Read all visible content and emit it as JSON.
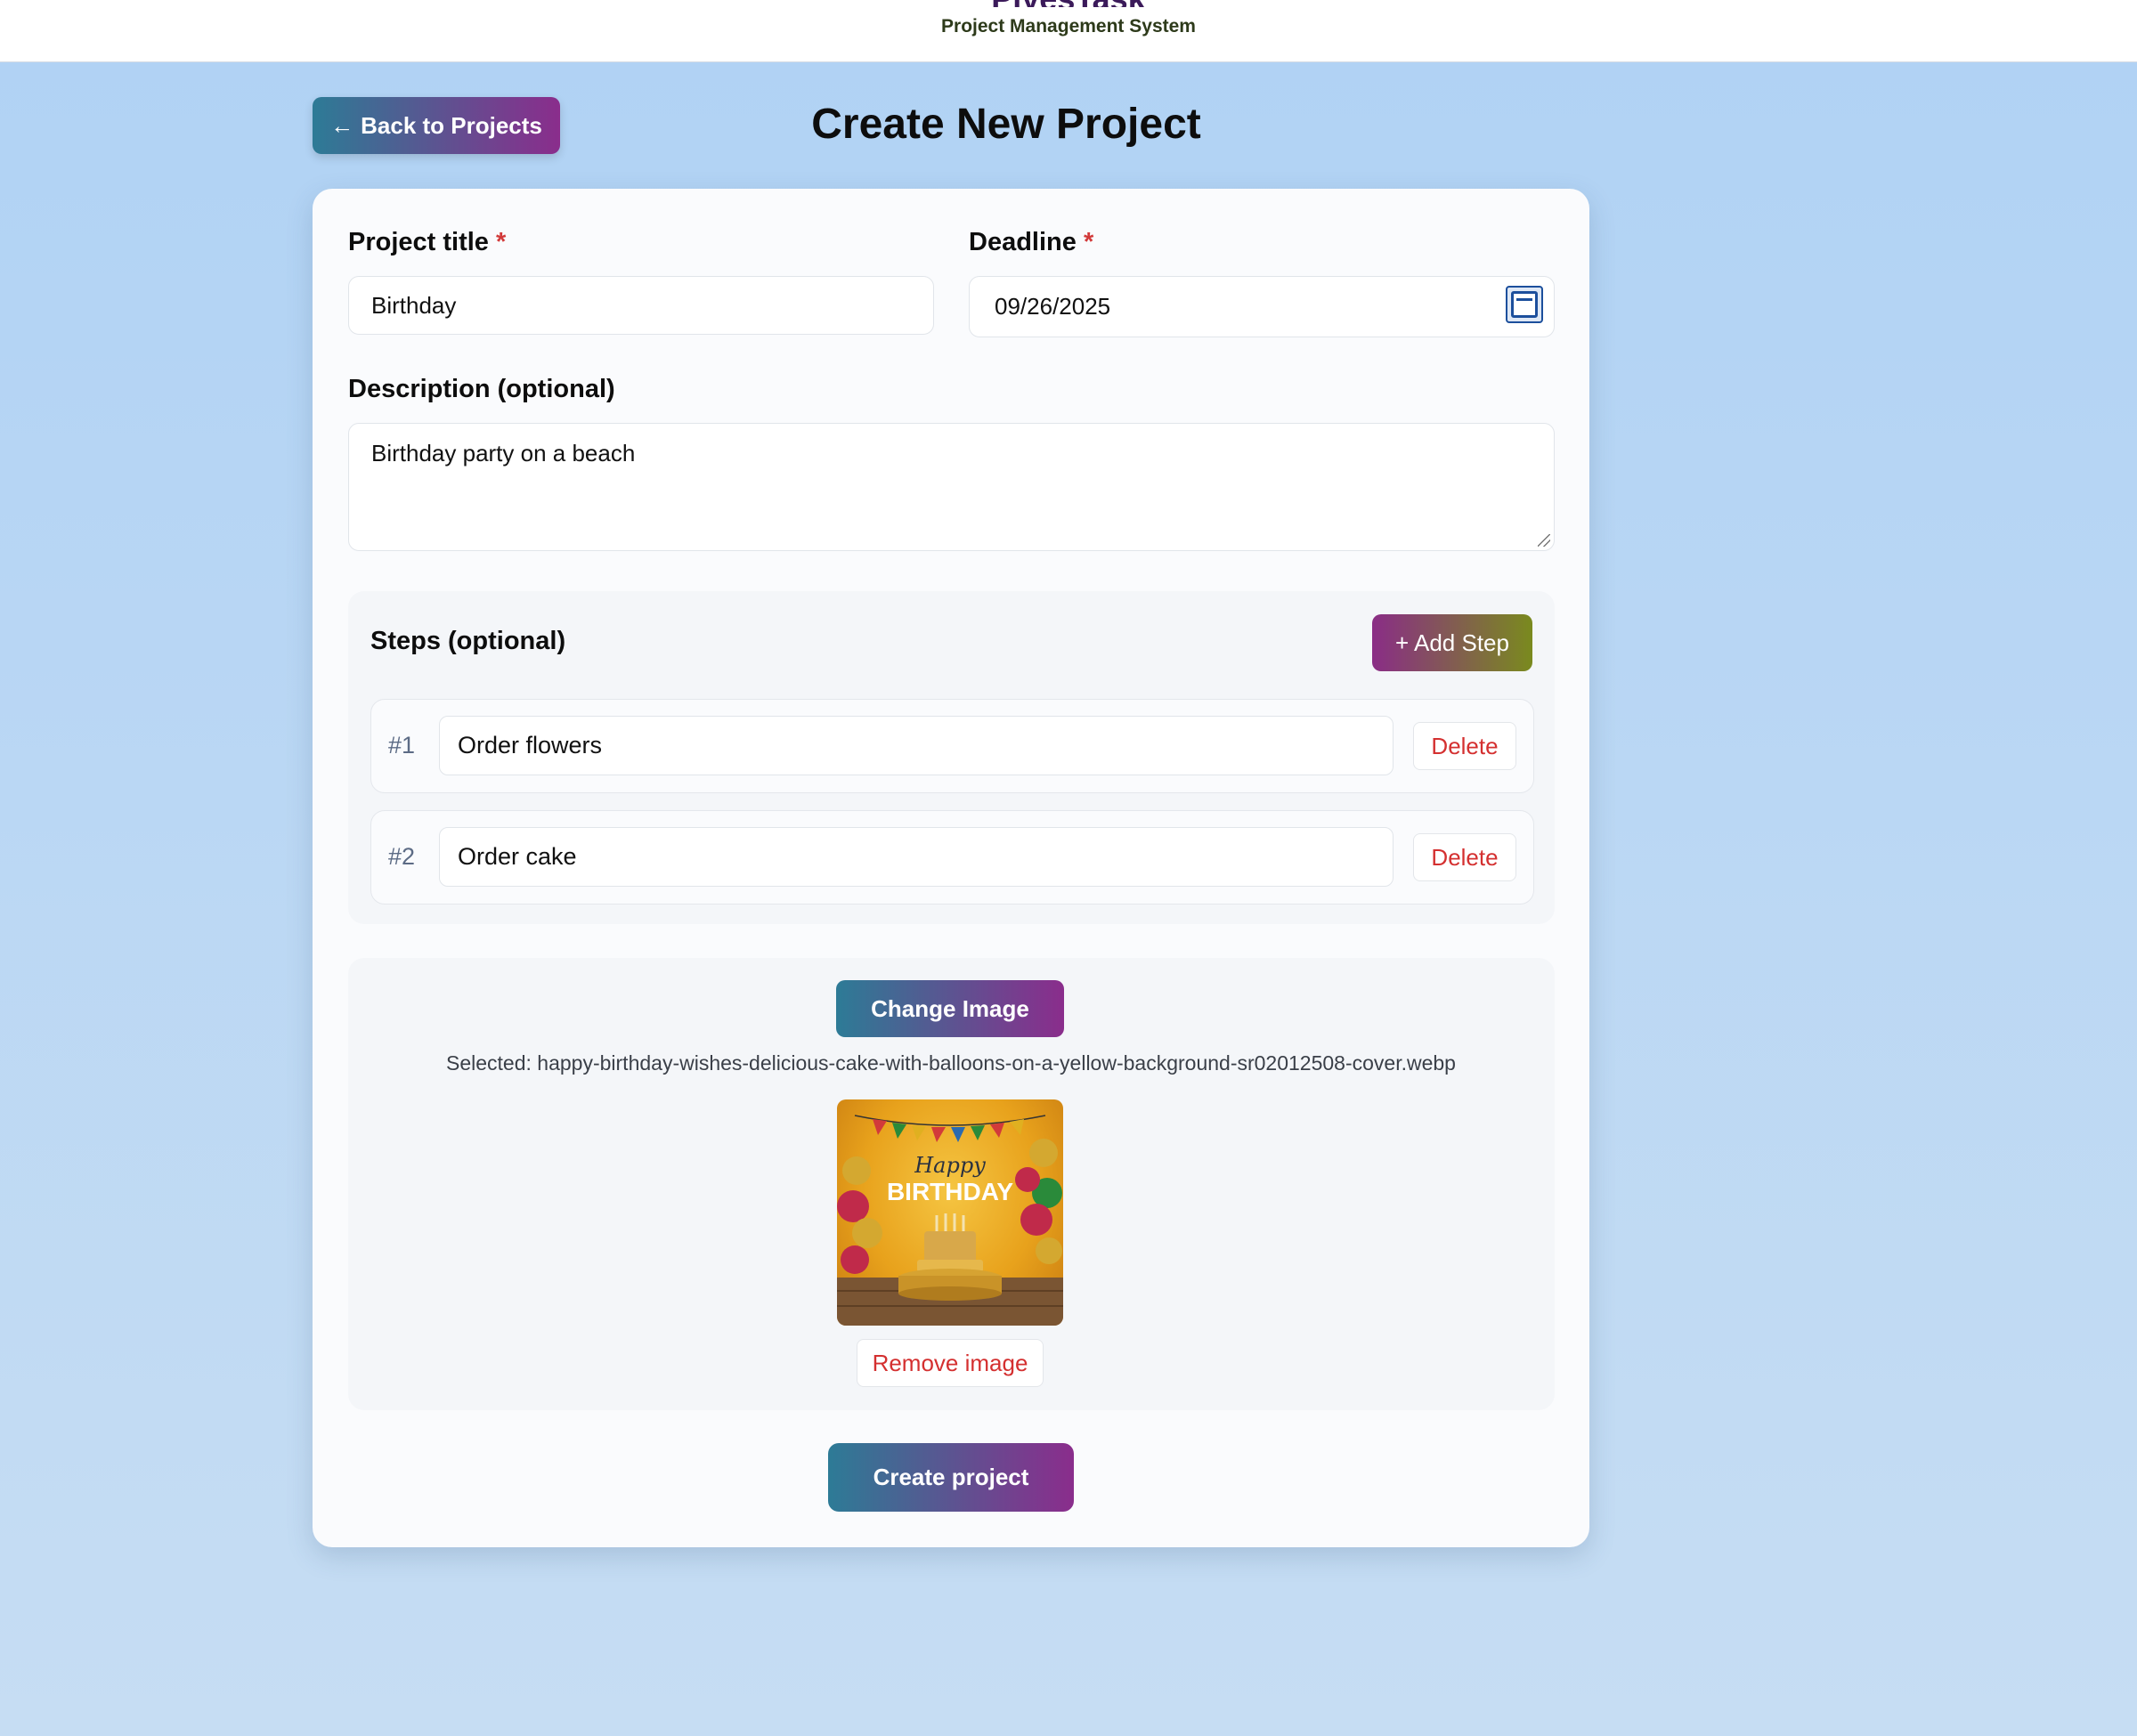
{
  "header": {
    "brand": "PlyesTask",
    "subtitle": "Project Management System"
  },
  "nav": {
    "back_arrow": "🡐",
    "back_label": "Back to Projects"
  },
  "page": {
    "title": "Create New Project"
  },
  "form": {
    "title_label": "Project title",
    "title_required": "*",
    "title_value": "Birthday",
    "deadline_label": "Deadline",
    "deadline_required": "*",
    "deadline_value": "09/26/2025",
    "description_label": "Description (optional)",
    "description_value": "Birthday party on a beach"
  },
  "steps": {
    "heading": "Steps (optional)",
    "add_label": "+ Add Step",
    "items": [
      {
        "number": "#1",
        "value": "Order flowers",
        "delete_label": "Delete"
      },
      {
        "number": "#2",
        "value": "Order cake",
        "delete_label": "Delete"
      }
    ]
  },
  "image": {
    "change_label": "Change Image",
    "selected_text": "Selected: happy-birthday-wishes-delicious-cake-with-balloons-on-a-yellow-background-sr02012508-cover.webp",
    "thumb_text_1": "Happy",
    "thumb_text_2": "BIRTHDAY",
    "remove_label": "Remove image"
  },
  "actions": {
    "create_label": "Create project"
  },
  "colors": {
    "accent_start": "#2d7b96",
    "accent_end": "#8a2d8c",
    "danger": "#d43030"
  }
}
